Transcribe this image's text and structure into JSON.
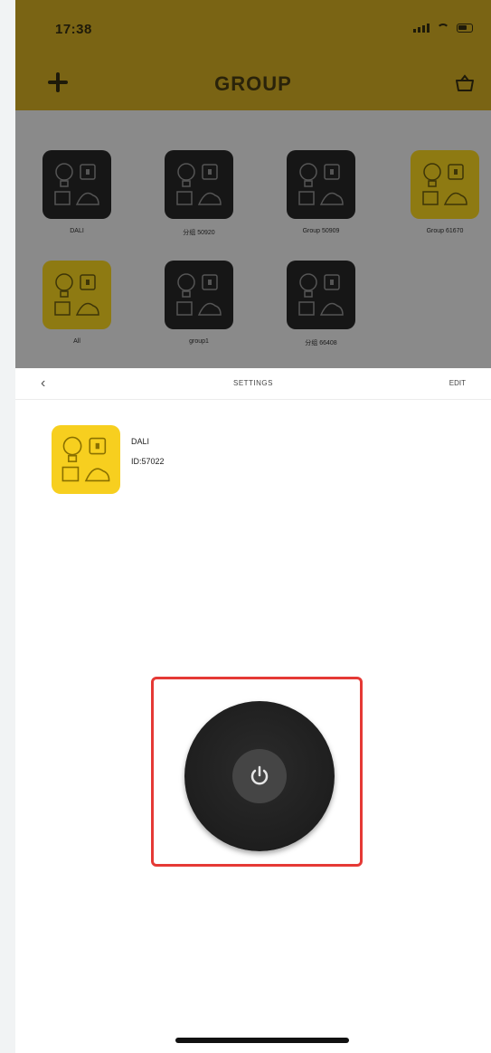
{
  "status_bar": {
    "time": "17:38"
  },
  "header": {
    "title": "GROUP"
  },
  "groups": [
    {
      "label": "DALI",
      "style": "dark"
    },
    {
      "label": "分组 50920",
      "style": "dark"
    },
    {
      "label": "Group 50909",
      "style": "dark"
    },
    {
      "label": "Group 61670",
      "style": "gold"
    },
    {
      "label": "All",
      "style": "gold"
    },
    {
      "label": "group1",
      "style": "dark"
    },
    {
      "label": "分组 66408",
      "style": "dark"
    }
  ],
  "settings_bar": {
    "back": "‹",
    "title": "SETTINGS",
    "edit": "EDIT"
  },
  "device": {
    "name": "DALI",
    "id": "ID:57022"
  },
  "colors": {
    "accent": "#f7cf1f",
    "highlight": "#e53935"
  }
}
